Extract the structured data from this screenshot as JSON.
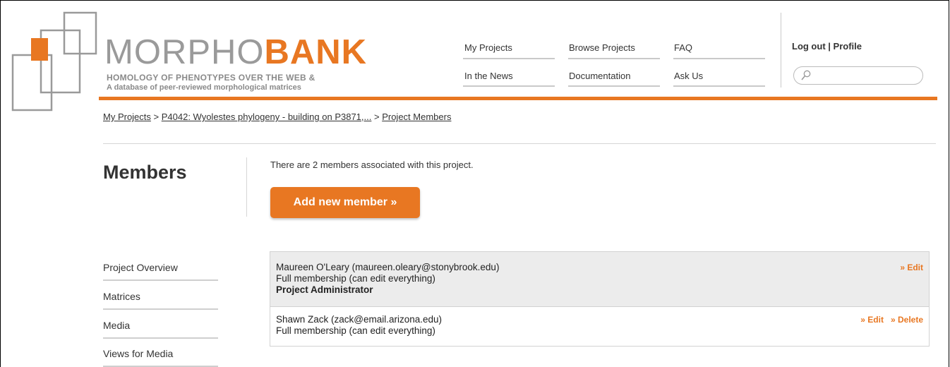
{
  "brand": {
    "name_part1": "MORPHO",
    "name_part2": "BANK",
    "tagline1": "HOMOLOGY OF PHENOTYPES OVER THE WEB &",
    "tagline2": "A database of peer-reviewed morphological matrices",
    "accent_color": "#e87722"
  },
  "nav": {
    "my_projects": "My Projects",
    "browse_projects": "Browse Projects",
    "faq": "FAQ",
    "in_the_news": "In the News",
    "documentation": "Documentation",
    "ask_us": "Ask Us"
  },
  "account": {
    "logout": "Log out",
    "separator": " | ",
    "profile": "Profile"
  },
  "search": {
    "placeholder": "",
    "value": "",
    "icon": "search-icon"
  },
  "breadcrumb": {
    "items": [
      "My Projects",
      "P4042: Wyolestes phylogeny - building on P3871,...",
      "Project Members"
    ],
    "separator": " > "
  },
  "page": {
    "title": "Members",
    "member_count_text": "There are 2 members associated with this project.",
    "add_button": "Add new member »"
  },
  "sidebar": {
    "items": [
      "Project Overview",
      "Matrices",
      "Media",
      "Views for Media"
    ]
  },
  "members": [
    {
      "name_email": "Maureen O'Leary (maureen.oleary@stonybrook.edu)",
      "membership": "Full membership (can edit everything)",
      "role": "Project Administrator",
      "edit": "» Edit"
    },
    {
      "name_email": "Shawn Zack (zack@email.arizona.edu)",
      "membership": "Full membership (can edit everything)",
      "edit": "» Edit",
      "delete": "» Delete"
    }
  ]
}
